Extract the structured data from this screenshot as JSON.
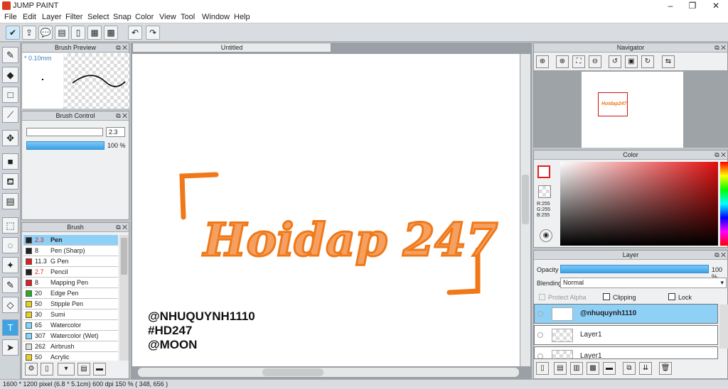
{
  "app": {
    "title": "JUMP PAINT",
    "min": "–",
    "max": "❐",
    "close": "✕"
  },
  "menu": [
    "File",
    "Edit",
    "Layer",
    "Filter",
    "Select",
    "Snap",
    "Color",
    "View",
    "Tool",
    "Window",
    "Help"
  ],
  "toolbar_icons": [
    "check-icon",
    "export-icon",
    "comment-icon",
    "message-icon",
    "page-icon",
    "page-edit-icon",
    "grid-edit-icon"
  ],
  "undo": "↶",
  "redo": "↷",
  "tools": [
    "pen-icon",
    "eraser-icon",
    "rect-icon",
    "line-icon",
    "move-icon",
    "fill-rect-icon",
    "bucket-icon",
    "gradient-icon",
    "select-rect-icon",
    "lasso-icon",
    "wand-icon",
    "select-pen-icon",
    "select-eraser-icon",
    "text-icon",
    "pointer-icon"
  ],
  "tool_glyphs": [
    "✎",
    "◆",
    "□",
    "⟋",
    "✥",
    "■",
    "⛾",
    "▤",
    "⬚",
    "◌",
    "✦",
    "✎",
    "◇",
    "T",
    "➤"
  ],
  "brush_preview": {
    "title": "Brush Preview",
    "size": "* 0.10mm"
  },
  "brush_control": {
    "title": "Brush Control",
    "size_value": "2.3",
    "opacity_value": "100 %",
    "opacity": 1.0
  },
  "brush": {
    "title": "Brush",
    "items": [
      {
        "size": "2.3",
        "name": "Pen",
        "color": "#222222",
        "sel": true
      },
      {
        "size": "8",
        "name": "Pen (Sharp)",
        "color": "#222222"
      },
      {
        "size": "11.3",
        "name": "G Pen",
        "color": "#e02020"
      },
      {
        "size": "2.7",
        "name": "Pencil",
        "color": "#222222"
      },
      {
        "size": "8",
        "name": "Mapping Pen",
        "color": "#e02020"
      },
      {
        "size": "20",
        "name": "Edge Pen",
        "color": "#20b020"
      },
      {
        "size": "50",
        "name": "Stipple Pen",
        "color": "#e8d020"
      },
      {
        "size": "30",
        "name": "Sumi",
        "color": "#e8d020"
      },
      {
        "size": "65",
        "name": "Watercolor",
        "color": "#80d8ff"
      },
      {
        "size": "307",
        "name": "Watercolor (Wet)",
        "color": "#80d8ff"
      },
      {
        "size": "262",
        "name": "Airbrush",
        "color": "#dddddd"
      },
      {
        "size": "50",
        "name": "Acrylic",
        "color": "#e8d020"
      }
    ]
  },
  "canvas": {
    "tab": "Untitled",
    "art_text": "Hoidap 247",
    "handles": [
      "@NHUQUYNH1110",
      "#HD247",
      "@MOON"
    ]
  },
  "navigator": {
    "title": "Navigator",
    "thumb_text": "Hoidap247"
  },
  "color": {
    "title": "Color",
    "r": "R:255",
    "g": "G:255",
    "b": "B:255",
    "primary": "#e02020",
    "secondary": "#f07820"
  },
  "layer": {
    "title": "Layer",
    "opacity_label": "Opacity",
    "opacity_value": "100 %",
    "opacity": 1.0,
    "blending_label": "Blending",
    "blending_value": "Normal",
    "protect_alpha": "Protect Alpha",
    "clipping": "Clipping",
    "lock": "Lock",
    "items": [
      {
        "name": "@nhuquynh1110",
        "sel": true
      },
      {
        "name": "Layer1"
      },
      {
        "name": "Layer1"
      }
    ]
  },
  "status": "1600 * 1200 pixel  (6.8 * 5.1cm)  600 dpi  150 %  ( 348, 656 )"
}
